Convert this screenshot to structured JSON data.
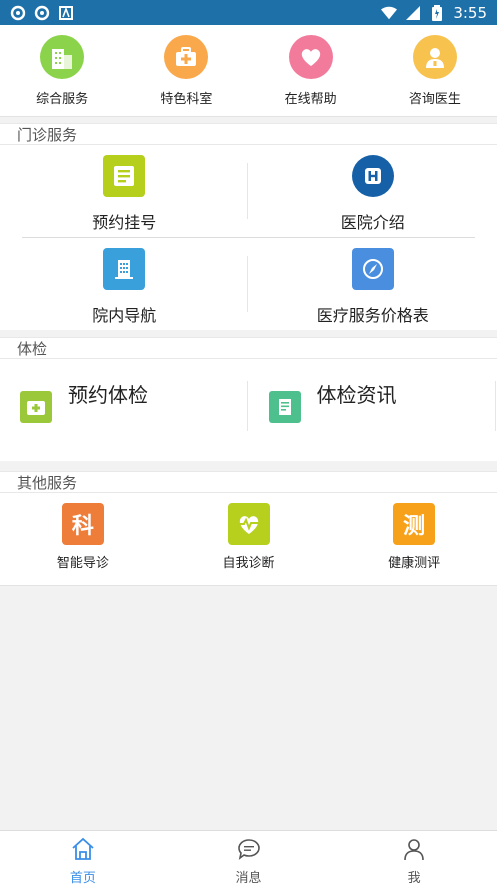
{
  "status_bar": {
    "time": "3:55",
    "left_icons": [
      "sync-icon",
      "sync-icon",
      "a-icon"
    ],
    "right_icons": [
      "wifi-icon",
      "signal-icon",
      "battery-icon"
    ]
  },
  "top_nav": [
    {
      "label": "综合服务",
      "icon": "building-icon",
      "color": "#8bd34a"
    },
    {
      "label": "特色科室",
      "icon": "first-aid-icon",
      "color": "#f9a84b"
    },
    {
      "label": "在线帮助",
      "icon": "heart-icon",
      "color": "#f27b9b"
    },
    {
      "label": "咨询医生",
      "icon": "doctor-icon",
      "color": "#f7c24e"
    }
  ],
  "outpatient": {
    "title": "门诊服务",
    "items": [
      {
        "label": "预约挂号",
        "icon": "register-icon",
        "color": "#b6cf1c"
      },
      {
        "label": "医院介绍",
        "icon": "hospital-icon",
        "color": "#1560a7"
      },
      {
        "label": "院内导航",
        "icon": "building-nav-icon",
        "color": "#3aa0dc"
      },
      {
        "label": "医疗服务价格表",
        "icon": "compass-icon",
        "color": "#4a8ee0"
      }
    ]
  },
  "exam": {
    "title": "体检",
    "items": [
      {
        "label": "预约体检",
        "icon": "medkit-icon",
        "color": "#9bc83a"
      },
      {
        "label": "体检资讯",
        "icon": "document-icon",
        "color": "#4ec08e"
      }
    ]
  },
  "other": {
    "title": "其他服务",
    "items": [
      {
        "label": "智能导诊",
        "icon": "ke-icon",
        "glyph": "科",
        "color": "#ef7d3a"
      },
      {
        "label": "自我诊断",
        "icon": "heartbeat-icon",
        "color": "#b7cf1d"
      },
      {
        "label": "健康测评",
        "icon": "ce-icon",
        "glyph": "测",
        "color": "#f7a11a"
      }
    ]
  },
  "tabbar": [
    {
      "label": "首页",
      "icon": "home-icon",
      "active": true
    },
    {
      "label": "消息",
      "icon": "message-icon",
      "active": false
    },
    {
      "label": "我",
      "icon": "user-icon",
      "active": false
    }
  ]
}
